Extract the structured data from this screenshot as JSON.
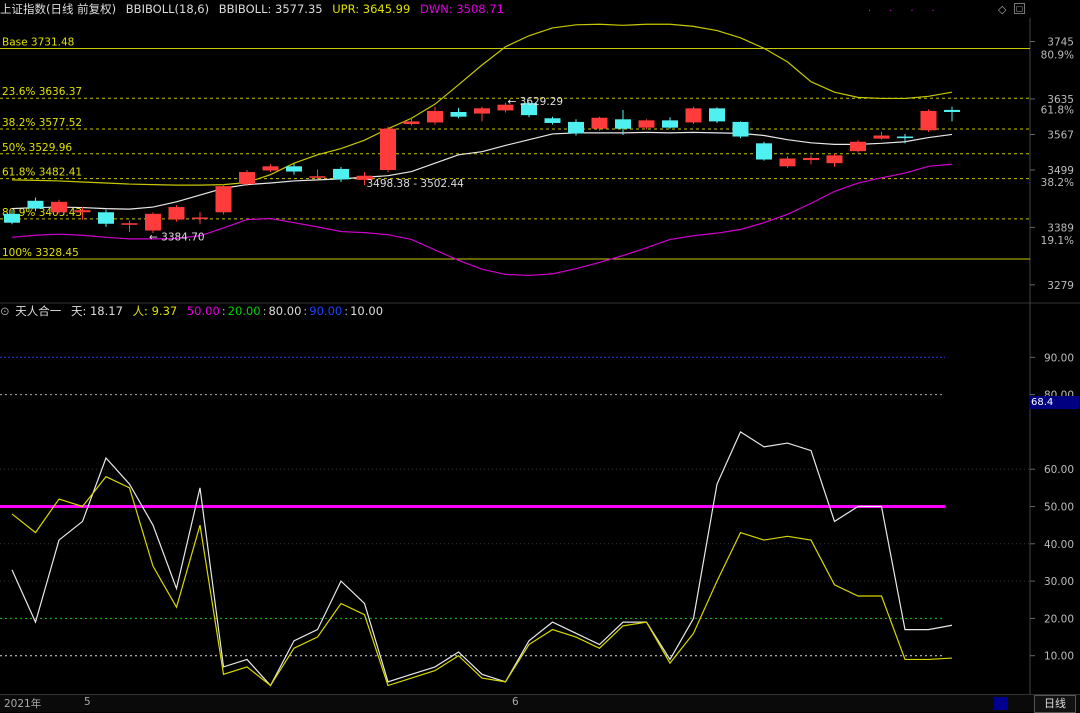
{
  "header": {
    "title": "上证指数(日线 前复权)",
    "indicator": "BBIBOLL(18,6)",
    "bbiboll": "BBIBOLL: 3577.35",
    "upr": "UPR: 3645.99",
    "dwn": "DWN: 3508.71",
    "colors": {
      "upr": "#e0e000",
      "dwn": "#e000e0"
    }
  },
  "sub_header": {
    "title": "天人合一",
    "tian": "天: 18.17",
    "ren": "人: 9.37",
    "l50": "50.00",
    "l20": "20.00",
    "l80": "80.00",
    "l90": "90.00",
    "l10": "10.00"
  },
  "fib_levels": [
    {
      "label": "Base 3731.48",
      "value": 3731.48,
      "style": "solid"
    },
    {
      "label": "23.6% 3636.37",
      "value": 3636.37,
      "style": "dash"
    },
    {
      "label": "38.2% 3577.52",
      "value": 3577.52,
      "style": "dash"
    },
    {
      "label": "50% 3529.96",
      "value": 3529.96,
      "style": "dash"
    },
    {
      "label": "61.8% 3482.41",
      "value": 3482.41,
      "style": "dash"
    },
    {
      "label": "80.9% 3405.43",
      "value": 3405.43,
      "style": "dash"
    },
    {
      "label": "100% 3328.45",
      "value": 3328.45,
      "style": "solid"
    }
  ],
  "price_axis": {
    "ticks": [
      {
        "label": "3745",
        "value": 3745
      },
      {
        "label": "3635",
        "value": 3635
      },
      {
        "label": "3567",
        "value": 3567
      },
      {
        "label": "3499",
        "value": 3499
      },
      {
        "label": "3389",
        "value": 3389
      },
      {
        "label": "3279",
        "value": 3279
      }
    ],
    "pct_ticks": [
      {
        "label": "80.9%",
        "value": 3720
      },
      {
        "label": "61.8%",
        "value": 3615
      },
      {
        "label": "38.2%",
        "value": 3476
      },
      {
        "label": "19.1%",
        "value": 3365
      }
    ]
  },
  "osc_axis": {
    "ticks": [
      {
        "label": "90.00",
        "value": 90
      },
      {
        "label": "80.00",
        "value": 80
      },
      {
        "label": "60.00",
        "value": 60
      },
      {
        "label": "50.00",
        "value": 50
      },
      {
        "label": "40.00",
        "value": 40
      },
      {
        "label": "30.00",
        "value": 30
      },
      {
        "label": "20.00",
        "value": 20
      },
      {
        "label": "10.00",
        "value": 10
      }
    ],
    "current": "68.4"
  },
  "annotations": {
    "low": "3384.70",
    "high": "3629.29",
    "range": "3498.38 - 3502.44"
  },
  "time_axis": {
    "year": "2021年",
    "m5": "5",
    "m6": "6"
  },
  "period_button": "日线",
  "chart_data": [
    {
      "type": "candlestick",
      "title": "上证指数(日线 前复权) BBIBOLL(18,6)",
      "ylim": [
        3250,
        3790
      ],
      "candles": [
        {
          "o": 3415,
          "c": 3398,
          "h": 3422,
          "l": 3395
        },
        {
          "o": 3440,
          "c": 3425,
          "h": 3446,
          "l": 3420
        },
        {
          "o": 3418,
          "c": 3438,
          "h": 3442,
          "l": 3415
        },
        {
          "o": 3418,
          "c": 3422,
          "h": 3428,
          "l": 3404
        },
        {
          "o": 3418,
          "c": 3396,
          "h": 3423,
          "l": 3390
        },
        {
          "o": 3394,
          "c": 3397,
          "h": 3402,
          "l": 3380
        },
        {
          "o": 3383,
          "c": 3415,
          "h": 3418,
          "l": 3378
        },
        {
          "o": 3404,
          "c": 3428,
          "h": 3432,
          "l": 3400
        },
        {
          "o": 3408,
          "c": 3408,
          "h": 3418,
          "l": 3395
        },
        {
          "o": 3418,
          "c": 3468,
          "h": 3472,
          "l": 3414
        },
        {
          "o": 3472,
          "c": 3495,
          "h": 3499,
          "l": 3468
        },
        {
          "o": 3498,
          "c": 3506,
          "h": 3510,
          "l": 3495
        },
        {
          "o": 3506,
          "c": 3496,
          "h": 3511,
          "l": 3490
        },
        {
          "o": 3484,
          "c": 3487,
          "h": 3500,
          "l": 3482
        },
        {
          "o": 3501,
          "c": 3481,
          "h": 3505,
          "l": 3476
        },
        {
          "o": 3480,
          "c": 3488,
          "h": 3495,
          "l": 3470
        },
        {
          "o": 3499,
          "c": 3578,
          "h": 3582,
          "l": 3495
        },
        {
          "o": 3587,
          "c": 3592,
          "h": 3600,
          "l": 3584
        },
        {
          "o": 3590,
          "c": 3612,
          "h": 3620,
          "l": 3586
        },
        {
          "o": 3610,
          "c": 3601,
          "h": 3618,
          "l": 3598
        },
        {
          "o": 3607,
          "c": 3617,
          "h": 3620,
          "l": 3592
        },
        {
          "o": 3613,
          "c": 3624,
          "h": 3628,
          "l": 3609
        },
        {
          "o": 3627,
          "c": 3604,
          "h": 3629,
          "l": 3600
        },
        {
          "o": 3598,
          "c": 3589,
          "h": 3601,
          "l": 3586
        },
        {
          "o": 3591,
          "c": 3569,
          "h": 3596,
          "l": 3565
        },
        {
          "o": 3578,
          "c": 3599,
          "h": 3601,
          "l": 3574
        },
        {
          "o": 3596,
          "c": 3578,
          "h": 3614,
          "l": 3566
        },
        {
          "o": 3580,
          "c": 3594,
          "h": 3596,
          "l": 3577
        },
        {
          "o": 3594,
          "c": 3580,
          "h": 3600,
          "l": 3578
        },
        {
          "o": 3590,
          "c": 3617,
          "h": 3620,
          "l": 3587
        },
        {
          "o": 3617,
          "c": 3592,
          "h": 3619,
          "l": 3589
        },
        {
          "o": 3591,
          "c": 3563,
          "h": 3592,
          "l": 3560
        },
        {
          "o": 3550,
          "c": 3519,
          "h": 3553,
          "l": 3517
        },
        {
          "o": 3506,
          "c": 3521,
          "h": 3525,
          "l": 3503
        },
        {
          "o": 3518,
          "c": 3522,
          "h": 3527,
          "l": 3510
        },
        {
          "o": 3512,
          "c": 3527,
          "h": 3530,
          "l": 3505
        },
        {
          "o": 3535,
          "c": 3553,
          "h": 3556,
          "l": 3532
        },
        {
          "o": 3559,
          "c": 3565,
          "h": 3572,
          "l": 3557
        },
        {
          "o": 3563,
          "c": 3560,
          "h": 3568,
          "l": 3550
        },
        {
          "o": 3575,
          "c": 3612,
          "h": 3615,
          "l": 3572
        },
        {
          "o": 3614,
          "c": 3610,
          "h": 3620,
          "l": 3592
        }
      ],
      "series": [
        {
          "key": "upr",
          "values": [
            3480,
            3479,
            3478,
            3476,
            3474,
            3472,
            3471,
            3470,
            3470,
            3471,
            3475,
            3490,
            3512,
            3528,
            3540,
            3556,
            3578,
            3598,
            3625,
            3662,
            3700,
            3735,
            3756,
            3771,
            3777,
            3778,
            3776,
            3778,
            3778,
            3774,
            3766,
            3752,
            3732,
            3706,
            3668,
            3648,
            3638,
            3636,
            3636,
            3640,
            3648
          ]
        },
        {
          "key": "bbiboll",
          "values": [
            3425,
            3427,
            3428,
            3427,
            3425,
            3424,
            3428,
            3438,
            3451,
            3464,
            3471,
            3474,
            3478,
            3480,
            3482,
            3485,
            3488,
            3496,
            3512,
            3528,
            3534,
            3546,
            3557,
            3568,
            3570,
            3570,
            3570,
            3571,
            3570,
            3571,
            3570,
            3569,
            3565,
            3557,
            3551,
            3548,
            3548,
            3550,
            3553,
            3561,
            3567
          ]
        },
        {
          "key": "dwn",
          "values": [
            3370,
            3374,
            3376,
            3374,
            3370,
            3367,
            3367,
            3368,
            3373,
            3388,
            3404,
            3406,
            3398,
            3390,
            3381,
            3379,
            3375,
            3366,
            3346,
            3326,
            3309,
            3299,
            3297,
            3300,
            3310,
            3322,
            3335,
            3350,
            3366,
            3373,
            3378,
            3385,
            3398,
            3414,
            3435,
            3458,
            3474,
            3484,
            3493,
            3506,
            3510
          ]
        }
      ]
    },
    {
      "type": "line",
      "title": "天人合一",
      "ylim": [
        0,
        100
      ],
      "hlines": [
        {
          "value": 90,
          "label": "90.00"
        },
        {
          "value": 80,
          "label": "80.00"
        },
        {
          "value": 50,
          "label": "50.00"
        },
        {
          "value": 20,
          "label": "20.00"
        },
        {
          "value": 10,
          "label": "10.00"
        }
      ],
      "series": [
        {
          "name": "天",
          "values": [
            33,
            19,
            41,
            46,
            63,
            56,
            45,
            28,
            55,
            7,
            9,
            2,
            14,
            17,
            30,
            24,
            3,
            5,
            7,
            11,
            5,
            3,
            14,
            19,
            16,
            13,
            19,
            19,
            9,
            20,
            56,
            70,
            66,
            67,
            65,
            46,
            50,
            50,
            17,
            17,
            18.17
          ]
        },
        {
          "name": "人",
          "values": [
            48,
            43,
            52,
            50,
            58,
            55,
            34,
            23,
            45,
            5,
            7,
            2,
            12,
            15,
            24,
            21,
            2,
            4,
            6,
            10,
            4,
            3,
            13,
            17,
            15,
            12,
            18,
            19,
            8,
            16,
            30,
            43,
            41,
            42,
            41,
            29,
            26,
            26,
            9,
            9,
            9.37
          ]
        }
      ]
    }
  ]
}
